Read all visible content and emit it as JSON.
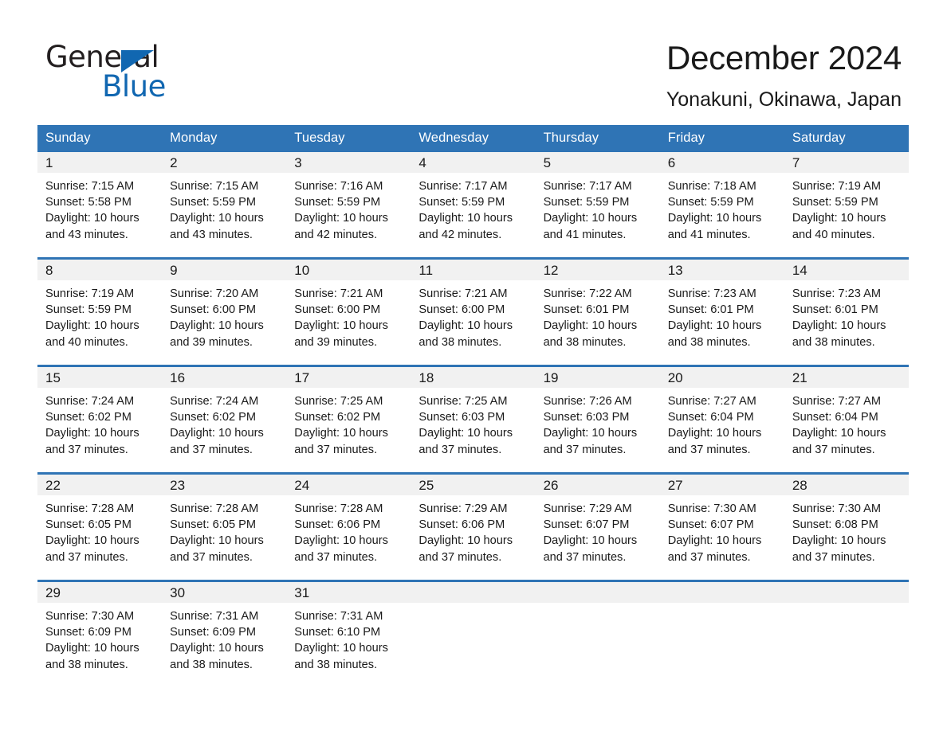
{
  "logo": {
    "word_one": "General",
    "word_two": "Blue",
    "triangle_color": "#1167b1",
    "icon": "triangle-icon"
  },
  "header": {
    "title": "December 2024",
    "subtitle": "Yonakuni, Okinawa, Japan"
  },
  "theme": {
    "header_blue": "#2f74b5",
    "day_band_gray": "#f1f1f1",
    "text_color": "#1a1a1a",
    "page_background": "#ffffff"
  },
  "calendar": {
    "weekday_headers": [
      "Sunday",
      "Monday",
      "Tuesday",
      "Wednesday",
      "Thursday",
      "Friday",
      "Saturday"
    ],
    "weeks": [
      [
        {
          "day": "1",
          "sunrise": "Sunrise: 7:15 AM",
          "sunset": "Sunset: 5:58 PM",
          "daylight_line1": "Daylight: 10 hours",
          "daylight_line2": "and 43 minutes."
        },
        {
          "day": "2",
          "sunrise": "Sunrise: 7:15 AM",
          "sunset": "Sunset: 5:59 PM",
          "daylight_line1": "Daylight: 10 hours",
          "daylight_line2": "and 43 minutes."
        },
        {
          "day": "3",
          "sunrise": "Sunrise: 7:16 AM",
          "sunset": "Sunset: 5:59 PM",
          "daylight_line1": "Daylight: 10 hours",
          "daylight_line2": "and 42 minutes."
        },
        {
          "day": "4",
          "sunrise": "Sunrise: 7:17 AM",
          "sunset": "Sunset: 5:59 PM",
          "daylight_line1": "Daylight: 10 hours",
          "daylight_line2": "and 42 minutes."
        },
        {
          "day": "5",
          "sunrise": "Sunrise: 7:17 AM",
          "sunset": "Sunset: 5:59 PM",
          "daylight_line1": "Daylight: 10 hours",
          "daylight_line2": "and 41 minutes."
        },
        {
          "day": "6",
          "sunrise": "Sunrise: 7:18 AM",
          "sunset": "Sunset: 5:59 PM",
          "daylight_line1": "Daylight: 10 hours",
          "daylight_line2": "and 41 minutes."
        },
        {
          "day": "7",
          "sunrise": "Sunrise: 7:19 AM",
          "sunset": "Sunset: 5:59 PM",
          "daylight_line1": "Daylight: 10 hours",
          "daylight_line2": "and 40 minutes."
        }
      ],
      [
        {
          "day": "8",
          "sunrise": "Sunrise: 7:19 AM",
          "sunset": "Sunset: 5:59 PM",
          "daylight_line1": "Daylight: 10 hours",
          "daylight_line2": "and 40 minutes."
        },
        {
          "day": "9",
          "sunrise": "Sunrise: 7:20 AM",
          "sunset": "Sunset: 6:00 PM",
          "daylight_line1": "Daylight: 10 hours",
          "daylight_line2": "and 39 minutes."
        },
        {
          "day": "10",
          "sunrise": "Sunrise: 7:21 AM",
          "sunset": "Sunset: 6:00 PM",
          "daylight_line1": "Daylight: 10 hours",
          "daylight_line2": "and 39 minutes."
        },
        {
          "day": "11",
          "sunrise": "Sunrise: 7:21 AM",
          "sunset": "Sunset: 6:00 PM",
          "daylight_line1": "Daylight: 10 hours",
          "daylight_line2": "and 38 minutes."
        },
        {
          "day": "12",
          "sunrise": "Sunrise: 7:22 AM",
          "sunset": "Sunset: 6:01 PM",
          "daylight_line1": "Daylight: 10 hours",
          "daylight_line2": "and 38 minutes."
        },
        {
          "day": "13",
          "sunrise": "Sunrise: 7:23 AM",
          "sunset": "Sunset: 6:01 PM",
          "daylight_line1": "Daylight: 10 hours",
          "daylight_line2": "and 38 minutes."
        },
        {
          "day": "14",
          "sunrise": "Sunrise: 7:23 AM",
          "sunset": "Sunset: 6:01 PM",
          "daylight_line1": "Daylight: 10 hours",
          "daylight_line2": "and 38 minutes."
        }
      ],
      [
        {
          "day": "15",
          "sunrise": "Sunrise: 7:24 AM",
          "sunset": "Sunset: 6:02 PM",
          "daylight_line1": "Daylight: 10 hours",
          "daylight_line2": "and 37 minutes."
        },
        {
          "day": "16",
          "sunrise": "Sunrise: 7:24 AM",
          "sunset": "Sunset: 6:02 PM",
          "daylight_line1": "Daylight: 10 hours",
          "daylight_line2": "and 37 minutes."
        },
        {
          "day": "17",
          "sunrise": "Sunrise: 7:25 AM",
          "sunset": "Sunset: 6:02 PM",
          "daylight_line1": "Daylight: 10 hours",
          "daylight_line2": "and 37 minutes."
        },
        {
          "day": "18",
          "sunrise": "Sunrise: 7:25 AM",
          "sunset": "Sunset: 6:03 PM",
          "daylight_line1": "Daylight: 10 hours",
          "daylight_line2": "and 37 minutes."
        },
        {
          "day": "19",
          "sunrise": "Sunrise: 7:26 AM",
          "sunset": "Sunset: 6:03 PM",
          "daylight_line1": "Daylight: 10 hours",
          "daylight_line2": "and 37 minutes."
        },
        {
          "day": "20",
          "sunrise": "Sunrise: 7:27 AM",
          "sunset": "Sunset: 6:04 PM",
          "daylight_line1": "Daylight: 10 hours",
          "daylight_line2": "and 37 minutes."
        },
        {
          "day": "21",
          "sunrise": "Sunrise: 7:27 AM",
          "sunset": "Sunset: 6:04 PM",
          "daylight_line1": "Daylight: 10 hours",
          "daylight_line2": "and 37 minutes."
        }
      ],
      [
        {
          "day": "22",
          "sunrise": "Sunrise: 7:28 AM",
          "sunset": "Sunset: 6:05 PM",
          "daylight_line1": "Daylight: 10 hours",
          "daylight_line2": "and 37 minutes."
        },
        {
          "day": "23",
          "sunrise": "Sunrise: 7:28 AM",
          "sunset": "Sunset: 6:05 PM",
          "daylight_line1": "Daylight: 10 hours",
          "daylight_line2": "and 37 minutes."
        },
        {
          "day": "24",
          "sunrise": "Sunrise: 7:28 AM",
          "sunset": "Sunset: 6:06 PM",
          "daylight_line1": "Daylight: 10 hours",
          "daylight_line2": "and 37 minutes."
        },
        {
          "day": "25",
          "sunrise": "Sunrise: 7:29 AM",
          "sunset": "Sunset: 6:06 PM",
          "daylight_line1": "Daylight: 10 hours",
          "daylight_line2": "and 37 minutes."
        },
        {
          "day": "26",
          "sunrise": "Sunrise: 7:29 AM",
          "sunset": "Sunset: 6:07 PM",
          "daylight_line1": "Daylight: 10 hours",
          "daylight_line2": "and 37 minutes."
        },
        {
          "day": "27",
          "sunrise": "Sunrise: 7:30 AM",
          "sunset": "Sunset: 6:07 PM",
          "daylight_line1": "Daylight: 10 hours",
          "daylight_line2": "and 37 minutes."
        },
        {
          "day": "28",
          "sunrise": "Sunrise: 7:30 AM",
          "sunset": "Sunset: 6:08 PM",
          "daylight_line1": "Daylight: 10 hours",
          "daylight_line2": "and 37 minutes."
        }
      ],
      [
        {
          "day": "29",
          "sunrise": "Sunrise: 7:30 AM",
          "sunset": "Sunset: 6:09 PM",
          "daylight_line1": "Daylight: 10 hours",
          "daylight_line2": "and 38 minutes."
        },
        {
          "day": "30",
          "sunrise": "Sunrise: 7:31 AM",
          "sunset": "Sunset: 6:09 PM",
          "daylight_line1": "Daylight: 10 hours",
          "daylight_line2": "and 38 minutes."
        },
        {
          "day": "31",
          "sunrise": "Sunrise: 7:31 AM",
          "sunset": "Sunset: 6:10 PM",
          "daylight_line1": "Daylight: 10 hours",
          "daylight_line2": "and 38 minutes."
        },
        {
          "day": "",
          "sunrise": "",
          "sunset": "",
          "daylight_line1": "",
          "daylight_line2": ""
        },
        {
          "day": "",
          "sunrise": "",
          "sunset": "",
          "daylight_line1": "",
          "daylight_line2": ""
        },
        {
          "day": "",
          "sunrise": "",
          "sunset": "",
          "daylight_line1": "",
          "daylight_line2": ""
        },
        {
          "day": "",
          "sunrise": "",
          "sunset": "",
          "daylight_line1": "",
          "daylight_line2": ""
        }
      ]
    ]
  }
}
